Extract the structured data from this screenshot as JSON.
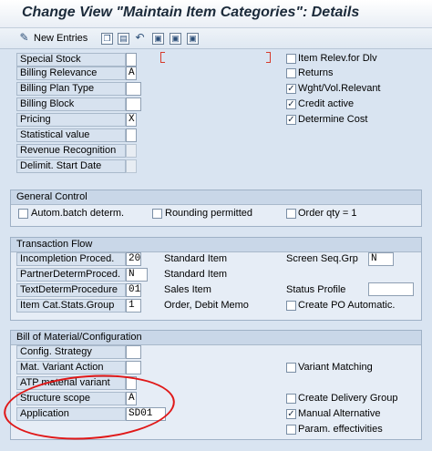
{
  "window": {
    "title": "Change View \"Maintain Item Categories\": Details"
  },
  "toolbar": {
    "new_entries": "New Entries",
    "icons": [
      "pencil-icon",
      "copy-icon",
      "delete-icon",
      "undo-icon",
      "nav-first-icon",
      "nav-prev-icon",
      "nav-next-icon"
    ]
  },
  "top": {
    "special_stock": {
      "label": "Special Stock",
      "value": ""
    },
    "billing_relevance": {
      "label": "Billing Relevance",
      "value": "A"
    },
    "billing_plan_type": {
      "label": "Billing Plan Type",
      "value": ""
    },
    "billing_block": {
      "label": "Billing Block",
      "value": ""
    },
    "pricing": {
      "label": "Pricing",
      "value": "X"
    },
    "statistical_value": {
      "label": "Statistical value",
      "value": ""
    },
    "revenue_recognition": {
      "label": "Revenue Recognition",
      "value": ""
    },
    "delimit_start_date": {
      "label": "Delimit. Start Date",
      "value": ""
    },
    "checkboxes": {
      "item_relev_dlv": {
        "label": "Item Relev.for Dlv",
        "checked": false
      },
      "returns": {
        "label": "Returns",
        "checked": false
      },
      "wght_vol_relevant": {
        "label": "Wght/Vol.Relevant",
        "checked": true
      },
      "credit_active": {
        "label": "Credit active",
        "checked": true
      },
      "determine_cost": {
        "label": "Determine Cost",
        "checked": true
      }
    }
  },
  "general_control": {
    "title": "General Control",
    "autom_batch": {
      "label": "Autom.batch determ.",
      "checked": false
    },
    "rounding_permitted": {
      "label": "Rounding permitted",
      "checked": false
    },
    "order_qty_1": {
      "label": "Order qty = 1",
      "checked": false
    }
  },
  "transaction_flow": {
    "title": "Transaction Flow",
    "incompletion_proced": {
      "label": "Incompletion Proced.",
      "value": "20",
      "desc": "Standard Item"
    },
    "partner_determ_proced": {
      "label": "PartnerDetermProced.",
      "value": "N",
      "desc": "Standard Item"
    },
    "text_determ_procedure": {
      "label": "TextDetermProcedure",
      "value": "01",
      "desc": "Sales Item"
    },
    "item_cat_stats_group": {
      "label": "Item Cat.Stats.Group",
      "value": "1",
      "desc": "Order, Debit Memo"
    },
    "screen_seq_grp": {
      "label": "Screen Seq.Grp",
      "value": "N"
    },
    "status_profile": {
      "label": "Status Profile",
      "value": ""
    },
    "create_po_automatic": {
      "label": "Create PO Automatic.",
      "checked": false
    }
  },
  "bom_config": {
    "title": "Bill of Material/Configuration",
    "config_strategy": {
      "label": "Config. Strategy",
      "value": ""
    },
    "mat_variant_action": {
      "label": "Mat. Variant Action",
      "value": ""
    },
    "atp_material_variant": {
      "label": "ATP material variant",
      "value": ""
    },
    "structure_scope": {
      "label": "Structure scope",
      "value": "A"
    },
    "application": {
      "label": "Application",
      "value": "SD01"
    },
    "variant_matching": {
      "label": "Variant Matching",
      "checked": false
    },
    "create_delivery_group": {
      "label": "Create Delivery Group",
      "checked": false
    },
    "manual_alternative": {
      "label": "Manual Alternative",
      "checked": true
    },
    "param_effectivities": {
      "label": "Param. effectivities",
      "checked": false
    }
  },
  "colors": {
    "background": "#d9e4f1",
    "annotation": "#e01818"
  }
}
